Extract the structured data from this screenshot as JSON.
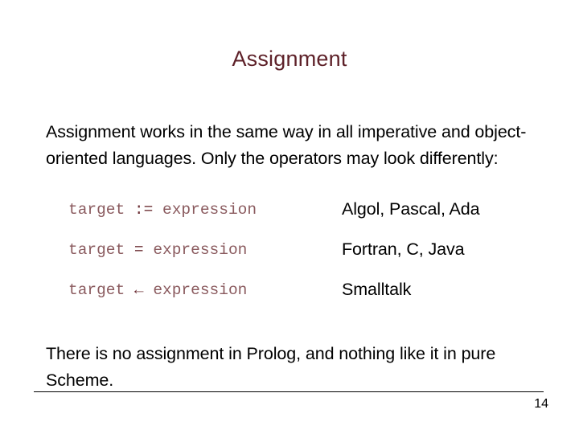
{
  "slide": {
    "title": "Assignment",
    "intro_paragraph": "Assignment works in the same way in all imperative and object-oriented languages. Only the operators may look differently:",
    "outro_paragraph": "There is no assignment in Prolog, and nothing like it in pure Scheme.",
    "operator_rows": [
      {
        "target": "target",
        "operator": ":=",
        "expression": "expression",
        "languages": "Algol, Pascal, Ada"
      },
      {
        "target": "target",
        "operator": "=",
        "expression": "expression",
        "languages": "Fortran, C, Java"
      },
      {
        "target": "target",
        "operator": "←",
        "expression": "expression",
        "languages": "Smalltalk"
      }
    ],
    "page_number": "14",
    "colors": {
      "title": "#5e2129",
      "code": "#8a5a5e",
      "operator": "#6d3036",
      "body": "#000000",
      "background": "#ffffff",
      "rule": "#000000"
    }
  }
}
